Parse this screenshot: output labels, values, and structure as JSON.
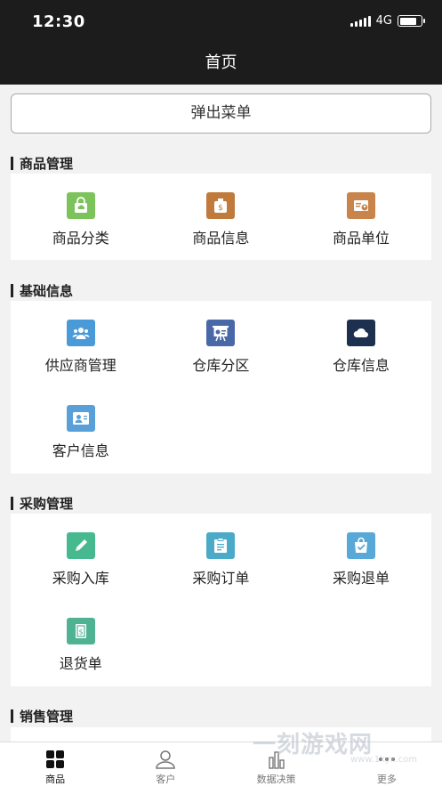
{
  "status_bar": {
    "time": "12:30",
    "network": "4G",
    "battery_level": 0.8
  },
  "nav": {
    "title": "首页"
  },
  "popup_button": {
    "label": "弹出菜单"
  },
  "sections": [
    {
      "title": "商品管理",
      "items": [
        {
          "label": "商品分类",
          "icon": "bag-icon",
          "color": "#7dc35b"
        },
        {
          "label": "商品信息",
          "icon": "money-bag-icon",
          "color": "#c07a3c"
        },
        {
          "label": "商品单位",
          "icon": "id-card-icon",
          "color": "#c8844a"
        }
      ]
    },
    {
      "title": "基础信息",
      "items": [
        {
          "label": "供应商管理",
          "icon": "people-group-icon",
          "color": "#4a9ad8"
        },
        {
          "label": "仓库分区",
          "icon": "presentation-board-icon",
          "color": "#4868a8"
        },
        {
          "label": "仓库信息",
          "icon": "cloud-icon",
          "color": "#1e3050"
        },
        {
          "label": "客户信息",
          "icon": "contact-card-icon",
          "color": "#5aa0d8"
        }
      ]
    },
    {
      "title": "采购管理",
      "items": [
        {
          "label": "采购入库",
          "icon": "pencil-icon",
          "color": "#46b98f"
        },
        {
          "label": "采购订单",
          "icon": "clipboard-icon",
          "color": "#4aaac8"
        },
        {
          "label": "采购退单",
          "icon": "checked-bag-icon",
          "color": "#58a8d8"
        },
        {
          "label": "退货单",
          "icon": "receipt-icon",
          "color": "#4fb393"
        }
      ]
    },
    {
      "title": "销售管理",
      "items": []
    }
  ],
  "tabs": [
    {
      "label": "商品",
      "icon": "grid-icon",
      "active": true
    },
    {
      "label": "客户",
      "icon": "person-icon",
      "active": false
    },
    {
      "label": "数据决策",
      "icon": "bar-chart-icon",
      "active": false
    },
    {
      "label": "更多",
      "icon": "more-dots-icon",
      "active": false
    }
  ],
  "watermark": {
    "text": "一刻游戏网",
    "sub": "www.1kyx.com"
  }
}
